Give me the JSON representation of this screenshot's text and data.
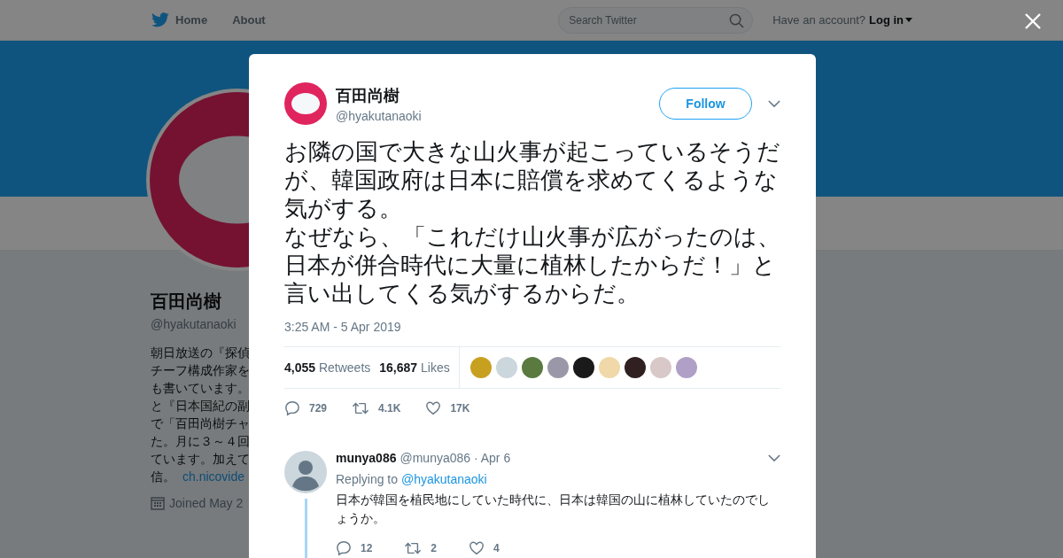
{
  "nav": {
    "links": [
      {
        "label": "Home"
      },
      {
        "label": "About"
      }
    ],
    "search": {
      "placeholder": "Search Twitter"
    },
    "account_prompt": "Have an account?",
    "login": "Log in"
  },
  "profile": {
    "name": "百田尚樹",
    "handle": "@hyakutanaoki",
    "bio_lines": [
      "朝日放送の『探偵",
      "チーフ構成作家を",
      "も書いています。",
      "と『日本国紀の副",
      "で「百田尚樹チャ",
      "た。月に３～４回",
      "ています。加えて"
    ],
    "bio_last": "信。",
    "bio_link": "ch.nicovide",
    "joined": "Joined May 2"
  },
  "tweet": {
    "name": "百田尚樹",
    "handle": "@hyakutanaoki",
    "follow": "Follow",
    "paragraphs": [
      "お隣の国で大きな山火事が起こっているそうだが、韓国政府は日本に賠償を求めてくるような気がする。",
      "なぜなら、「これだけ山火事が広がったのは、日本が併合時代に大量に植林したからだ！」と言い出してくる気がするからだ。"
    ],
    "time": "3:25 AM - 5 Apr 2019",
    "retweets": {
      "count": "4,055",
      "label": "Retweets"
    },
    "likes": {
      "count": "16,687",
      "label": "Likes"
    },
    "likers": [
      {
        "color": "#c8a020"
      },
      {
        "color": "#ccd6dd"
      },
      {
        "color": "#5a7a40"
      },
      {
        "color": "#9a98a8"
      },
      {
        "color": "#1a1a1a"
      },
      {
        "color": "#f0d8a8"
      },
      {
        "color": "#302020"
      },
      {
        "color": "#d8c8c8"
      },
      {
        "color": "#b0a0c8"
      }
    ],
    "actions": {
      "replies": "729",
      "retweets": "4.1K",
      "likes": "17K"
    }
  },
  "reply": {
    "name": "munya086",
    "handle": "@munya086",
    "date": "· Apr 6",
    "replying_to": "Replying to",
    "mention": "@hyakutanaoki",
    "text": "日本が韓国を植民地にしていた時代に、日本は韓国の山に植林していたのでしょうか。",
    "actions": {
      "replies": "12",
      "retweets": "2",
      "likes": "4"
    }
  }
}
